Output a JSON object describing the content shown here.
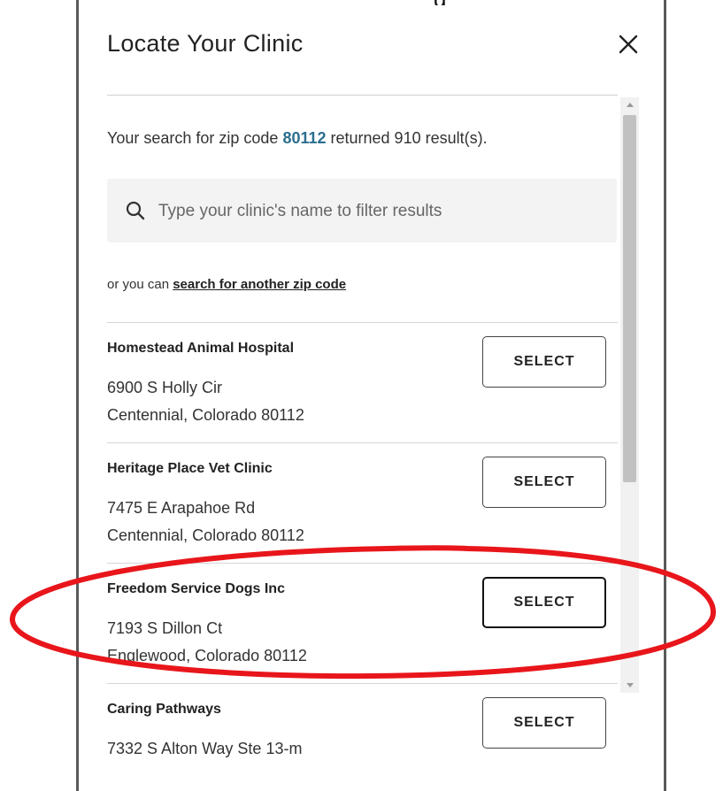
{
  "modal": {
    "title": "Locate Your Clinic",
    "close_icon": "close-icon",
    "top_peek_text": "g"
  },
  "search": {
    "summary_prefix": "Your search for zip code ",
    "zip": "80112",
    "summary_suffix": " returned 910 result(s).",
    "filter_placeholder": "Type your clinic's name to filter results",
    "filter_value": "",
    "alt_prefix": "or you can ",
    "alt_link": "search for another zip code"
  },
  "clinics": [
    {
      "name": "Homestead Animal Hospital",
      "address": "6900 S Holly Cir",
      "city": "Centennial, Colorado 80112",
      "button": "SELECT"
    },
    {
      "name": "Heritage Place Vet Clinic",
      "address": "7475 E Arapahoe Rd",
      "city": "Centennial, Colorado 80112",
      "button": "SELECT"
    },
    {
      "name": "Freedom Service Dogs Inc",
      "address": "7193 S Dillon Ct",
      "city": "Englewood, Colorado 80112",
      "button": "SELECT"
    },
    {
      "name": "Caring Pathways",
      "address": "7332 S Alton Way Ste 13-m",
      "city": "",
      "button": "SELECT"
    }
  ],
  "colors": {
    "zip_accent": "#2b6f8e",
    "highlight_ring": "#e8161b",
    "frame_edge": "#5a5a5a"
  }
}
